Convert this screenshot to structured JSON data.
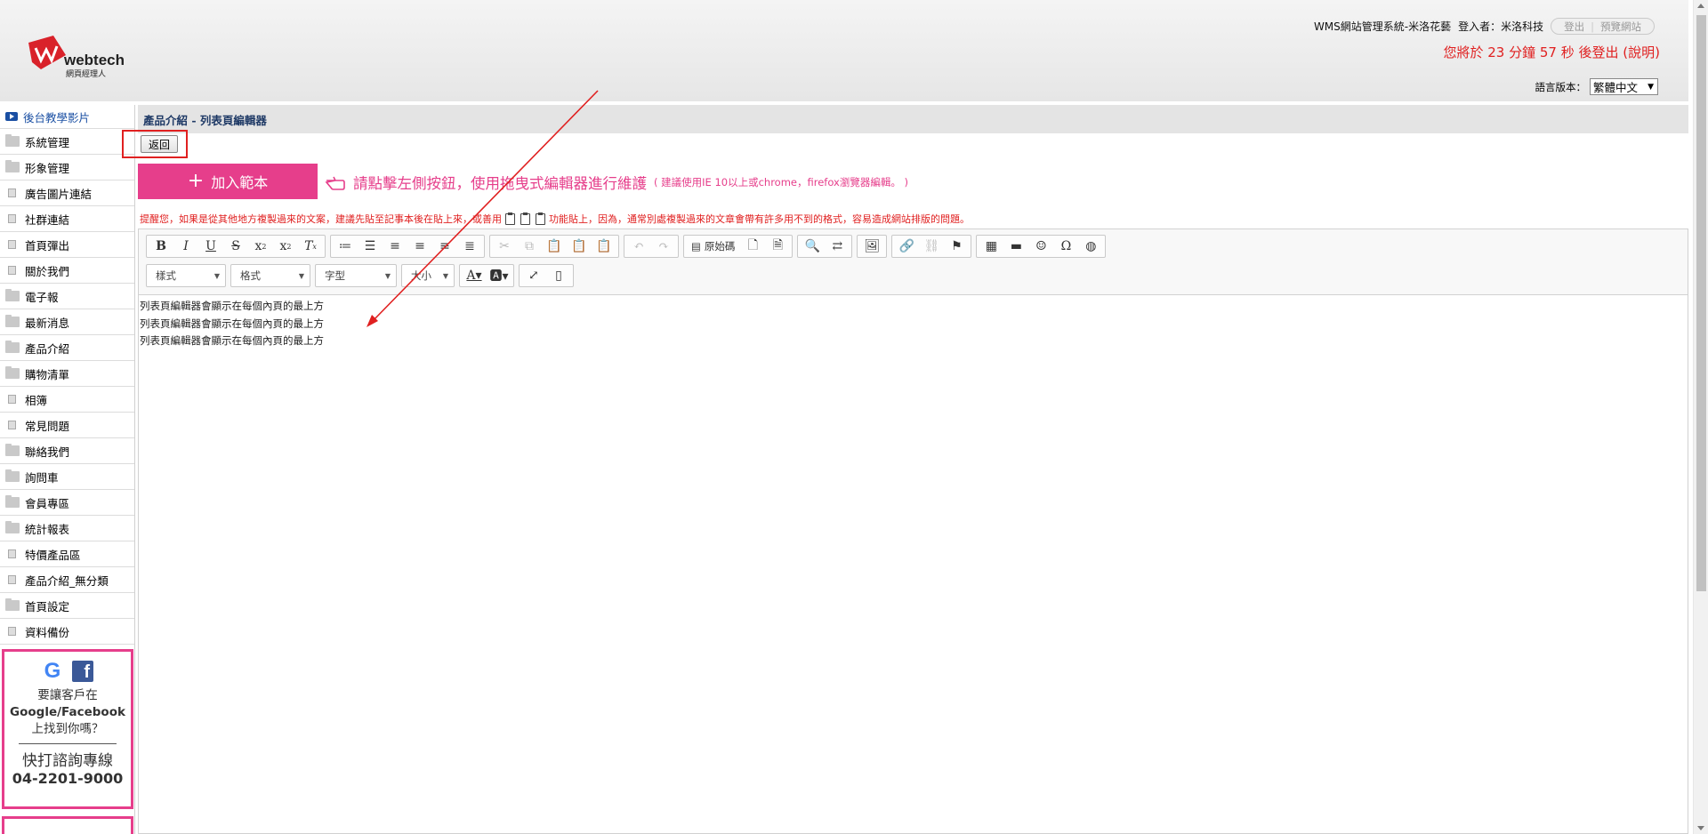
{
  "header": {
    "logo_text": "webtech",
    "logo_sub": "網頁經理人",
    "system_name": "WMS網站管理系統-米洛花藝",
    "login_label": "登入者：米洛科技",
    "logout_button": "登出",
    "preview_button": "預覽網站",
    "logout_timer": "您將於 23 分鐘 57 秒 後登出 (說明)",
    "lang_label": "語言版本：",
    "lang_value": "繁體中文"
  },
  "sidebar": {
    "items": [
      {
        "label": "後台教學影片",
        "icon": "video-icon"
      },
      {
        "label": "系統管理",
        "icon": "folder-icon"
      },
      {
        "label": "形象管理",
        "icon": "folder-icon"
      },
      {
        "label": "廣告圖片連結",
        "icon": "doc-icon"
      },
      {
        "label": "社群連結",
        "icon": "doc-icon"
      },
      {
        "label": "首頁彈出",
        "icon": "doc-icon"
      },
      {
        "label": "關於我們",
        "icon": "doc-icon"
      },
      {
        "label": "電子報",
        "icon": "folder-icon"
      },
      {
        "label": "最新消息",
        "icon": "folder-icon"
      },
      {
        "label": "產品介紹",
        "icon": "folder-icon"
      },
      {
        "label": "購物清單",
        "icon": "folder-icon"
      },
      {
        "label": "相簿",
        "icon": "doc-icon"
      },
      {
        "label": "常見問題",
        "icon": "doc-icon"
      },
      {
        "label": "聯絡我們",
        "icon": "folder-icon"
      },
      {
        "label": "詢問車",
        "icon": "folder-icon"
      },
      {
        "label": "會員專區",
        "icon": "folder-icon"
      },
      {
        "label": "統計報表",
        "icon": "folder-icon"
      },
      {
        "label": "特價產品區",
        "icon": "doc-icon"
      },
      {
        "label": "產品介紹_無分類",
        "icon": "doc-icon"
      },
      {
        "label": "首頁設定",
        "icon": "folder-icon"
      },
      {
        "label": "資料備份",
        "icon": "doc-icon"
      }
    ],
    "promo": {
      "g": "G",
      "f": "f",
      "line1": "要讓客戶在",
      "line2": "Google/Facebook",
      "line3": "上找到你嗎？",
      "call": "快打諮詢專線",
      "phone": "04-2201-9000"
    }
  },
  "main": {
    "title": "產品介紹 - 列表頁編輯器",
    "back_button": "返回",
    "add_template": "加入範本",
    "plus": "+",
    "hint": "請點擊左側按鈕，使用拖曳式編輯器進行維護",
    "hint_sub": "( 建議使用IE 10以上或chrome，firefox瀏覽器編輯。 )",
    "notice_a": "提醒您，如果是從其他地方複製過來的文案，建議先貼至記事本後在貼上來，或善用",
    "notice_b": "功能貼上，因為，通常別處複製過來的文章會帶有許多用不到的格式，容易造成網站排版的問題。"
  },
  "editor": {
    "source_label": "原始碼",
    "combo_style": "樣式",
    "combo_format": "格式",
    "combo_font": "字型",
    "combo_size": "大小",
    "lines": [
      "列表頁編輯器會顯示在每個內頁的最上方",
      "列表頁編輯器會顯示在每個內頁的最上方",
      "列表頁編輯器會顯示在每個內頁的最上方"
    ]
  },
  "colors": {
    "accent_pink": "#e63e8b",
    "alert_red": "#e02020",
    "title_navy": "#1f3a66"
  }
}
